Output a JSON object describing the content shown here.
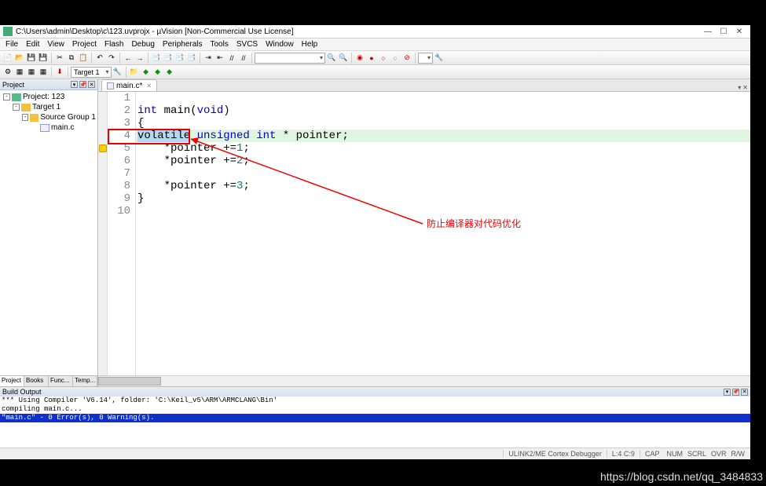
{
  "window": {
    "title": "C:\\Users\\admin\\Desktop\\c\\123.uvprojx - µVision  [Non-Commercial Use License]"
  },
  "menu": [
    "File",
    "Edit",
    "View",
    "Project",
    "Flash",
    "Debug",
    "Peripherals",
    "Tools",
    "SVCS",
    "Window",
    "Help"
  ],
  "toolbar2": {
    "target_combo": "Target 1"
  },
  "project_pane": {
    "title": "Project",
    "root": "Project: 123",
    "target": "Target 1",
    "group": "Source Group 1",
    "file": "main.c",
    "tabs": [
      "Project",
      "Books",
      "Func...",
      "Temp..."
    ]
  },
  "editor": {
    "tab": "main.c*",
    "lines": {
      "n1": "1",
      "n2": "2",
      "n3": "3",
      "n4": "4",
      "n5": "5",
      "n6": "6",
      "n7": "7",
      "n8": "8",
      "n9": "9",
      "n10": "10"
    },
    "code": {
      "l1": "",
      "l2_kw1": "int",
      "l2_id": " main",
      "l2_paren": "(",
      "l2_kw2": "void",
      "l2_paren2": ")",
      "l3": "{",
      "l4_sel": "volatile",
      "l4_sp": " ",
      "l4_kw": "unsigned int",
      "l4_rest": " * pointer;",
      "l5_pre": "    *pointer +=",
      "l5_num": "1",
      "l5_post": ";",
      "l6_pre": "    *pointer +=",
      "l6_num": "2",
      "l6_post": ";",
      "l7": "",
      "l8_pre": "    *pointer +=",
      "l8_num": "3",
      "l8_post": ";",
      "l9": "}",
      "l10": ""
    },
    "annotation": "防止编译器对代码优化"
  },
  "build": {
    "title": "Build Output",
    "l1": "*** Using Compiler 'V6.14', folder: 'C:\\Keil_v5\\ARM\\ARMCLANG\\Bin'",
    "l2": "compiling main.c...",
    "l3": "\"main.c\" - 0 Error(s), 0 Warning(s)."
  },
  "status": {
    "debugger": "ULINK2/ME Cortex Debugger",
    "pos": "L:4 C:9",
    "cap": "CAP",
    "num": "NUM",
    "scrl": "SCRL",
    "ovr": "OVR",
    "rw": "R/W"
  },
  "watermark": "https://blog.csdn.net/qq_3484833"
}
